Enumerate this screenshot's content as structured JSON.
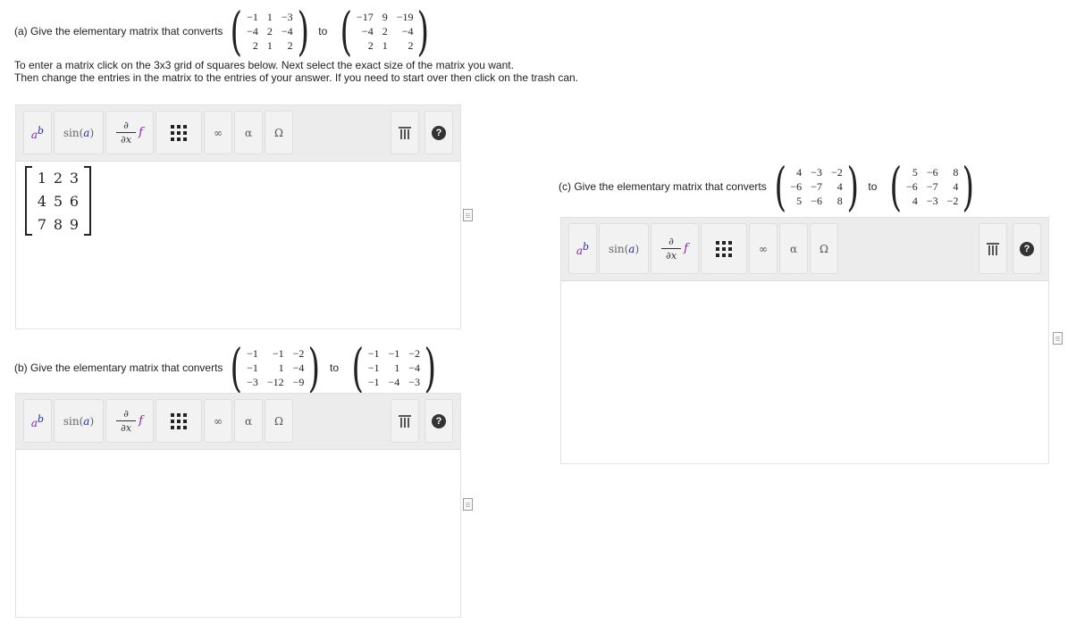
{
  "questions": {
    "a": {
      "prompt": "(a) Give the elementary matrix that converts",
      "to": "to",
      "from_matrix": [
        [
          "−1",
          "1",
          "−3"
        ],
        [
          "−4",
          "2",
          "−4"
        ],
        [
          "2",
          "1",
          "2"
        ]
      ],
      "to_matrix": [
        [
          "−17",
          "9",
          "−19"
        ],
        [
          "−4",
          "2",
          "−4"
        ],
        [
          "2",
          "1",
          "2"
        ]
      ]
    },
    "b": {
      "prompt": "(b) Give the elementary matrix that converts",
      "to": "to",
      "from_matrix": [
        [
          "−1",
          "−1",
          "−2"
        ],
        [
          "−1",
          "1",
          "−4"
        ],
        [
          "−3",
          "−12",
          "−9"
        ]
      ],
      "to_matrix": [
        [
          "−1",
          "−1",
          "−2"
        ],
        [
          "−1",
          "1",
          "−4"
        ],
        [
          "−1",
          "−4",
          "−3"
        ]
      ]
    },
    "c": {
      "prompt": "(c) Give the elementary matrix that converts",
      "to": "to",
      "from_matrix": [
        [
          "4",
          "−3",
          "−2"
        ],
        [
          "−6",
          "−7",
          "4"
        ],
        [
          "5",
          "−6",
          "8"
        ]
      ],
      "to_matrix": [
        [
          "5",
          "−6",
          "8"
        ],
        [
          "−6",
          "−7",
          "4"
        ],
        [
          "4",
          "−3",
          "−2"
        ]
      ]
    }
  },
  "instructions": {
    "line1": "To enter a matrix click on the 3x3 grid of squares below. Next select the exact size of the matrix you want.",
    "line2": "Then change the entries in the matrix to the entries of your answer. If you need to start over then click on the trash can."
  },
  "toolbar": {
    "power_base": "a",
    "power_exp": "b",
    "sin_fn": "sin",
    "sin_arg": "a",
    "deriv_num": "∂",
    "deriv_den": "∂x",
    "deriv_f": "f",
    "infinity": "∞",
    "alpha": "α",
    "omega": "Ω",
    "help": "?"
  },
  "editor_a_matrix": [
    [
      "1",
      "2",
      "3"
    ],
    [
      "4",
      "5",
      "6"
    ],
    [
      "7",
      "8",
      "9"
    ]
  ]
}
